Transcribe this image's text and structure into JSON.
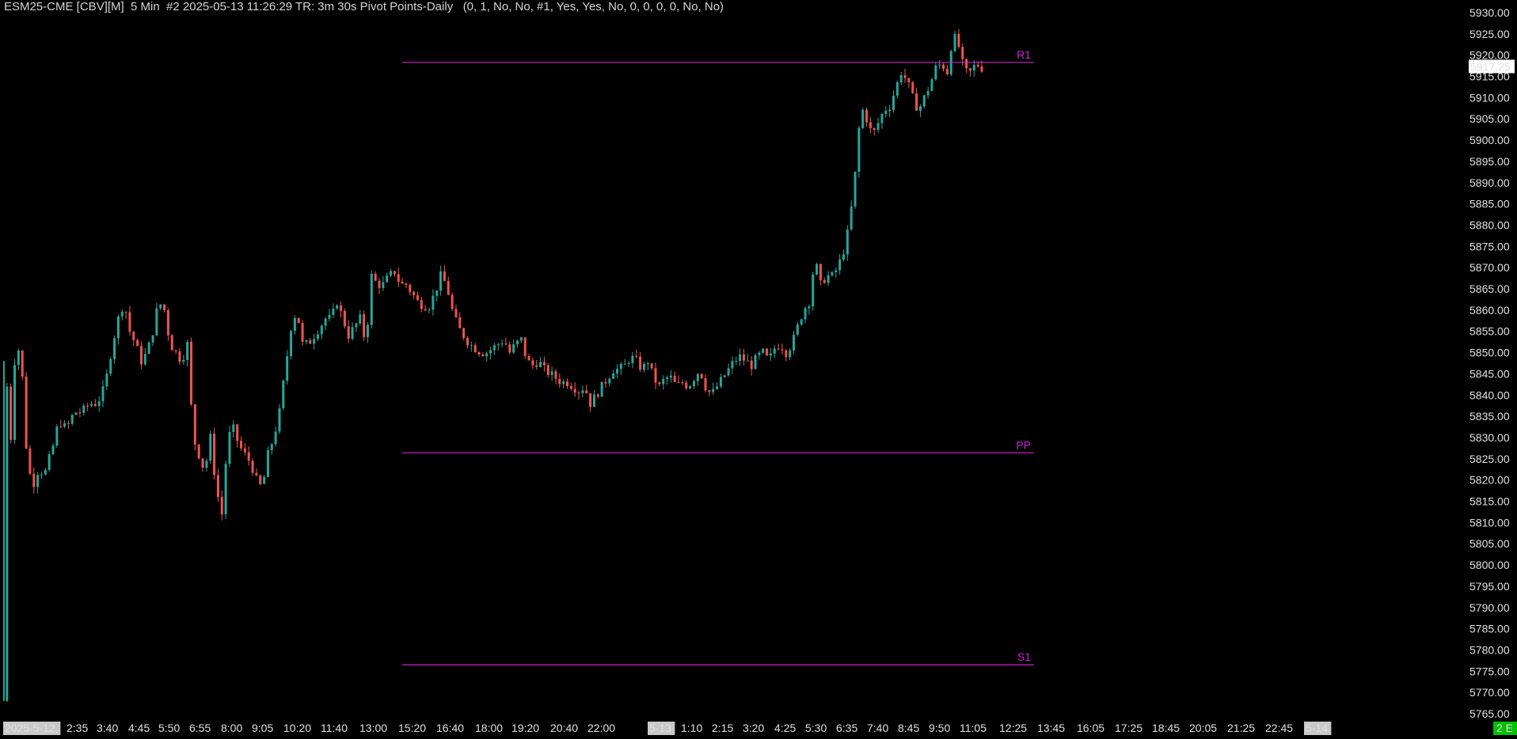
{
  "header": {
    "title": "ESM25-CME [CBV][M]  5 Min  #2 2025-05-13 11:26:29 TR: 3m 30s Pivot Points-Daily   (0, 1, No, No, #1, Yes, Yes, No, 0, 0, 0, 0, No, No)"
  },
  "colors": {
    "background": "#000000",
    "up_candle": "#26a69a",
    "down_candle": "#ef5350",
    "pivot_line": "#d020d0",
    "current_price_bg": "#ffffff",
    "current_price_text": "#000000",
    "date_marker_bg": "#c8c8c8",
    "status_badge_bg": "#00c000"
  },
  "chart_data": {
    "type": "candlestick",
    "symbol": "ESM25-CME [CBV][M]",
    "interval": "5 Min",
    "ylim": [
      5765,
      5930
    ],
    "y_ticks": [
      "5930.00",
      "5925.00",
      "5920.00",
      "5915.00",
      "5910.00",
      "5905.00",
      "5900.00",
      "5895.00",
      "5890.00",
      "5885.00",
      "5880.00",
      "5875.00",
      "5870.00",
      "5865.00",
      "5860.00",
      "5855.00",
      "5850.00",
      "5845.00",
      "5840.00",
      "5835.00",
      "5830.00",
      "5825.00",
      "5820.00",
      "5815.00",
      "5810.00",
      "5805.00",
      "5800.00",
      "5795.00",
      "5790.00",
      "5785.00",
      "5780.00",
      "5775.00",
      "5770.00",
      "5765.00"
    ],
    "x_ticks": [
      {
        "label": "2025-5-12",
        "boxed": true
      },
      {
        "label": "2:35"
      },
      {
        "label": "3:40"
      },
      {
        "label": "4:45"
      },
      {
        "label": "5:50"
      },
      {
        "label": "6:55"
      },
      {
        "label": "8:00"
      },
      {
        "label": "9:05"
      },
      {
        "label": "10:20"
      },
      {
        "label": "11:40"
      },
      {
        "label": "13:00"
      },
      {
        "label": "15:20"
      },
      {
        "label": "16:40"
      },
      {
        "label": "18:00"
      },
      {
        "label": "19:20"
      },
      {
        "label": "20:40"
      },
      {
        "label": "22:00"
      },
      {
        "label": "5-13",
        "boxed": true
      },
      {
        "label": "1:10"
      },
      {
        "label": "2:15"
      },
      {
        "label": "3:20"
      },
      {
        "label": "4:25"
      },
      {
        "label": "5:30"
      },
      {
        "label": "6:35"
      },
      {
        "label": "7:40"
      },
      {
        "label": "8:45"
      },
      {
        "label": "9:50"
      },
      {
        "label": "11:05"
      },
      {
        "label": "12:25"
      },
      {
        "label": "13:45"
      },
      {
        "label": "16:05"
      },
      {
        "label": "17:25"
      },
      {
        "label": "18:45"
      },
      {
        "label": "20:05"
      },
      {
        "label": "21:25"
      },
      {
        "label": "22:45"
      },
      {
        "label": "5-14",
        "boxed": true
      }
    ],
    "current_price": "5917.25",
    "pivot_levels": [
      {
        "name": "R1",
        "value": 5918.3
      },
      {
        "name": "PP",
        "value": 5826.4
      },
      {
        "name": "S1",
        "value": 5776.5
      }
    ],
    "price_path": [
      [
        0,
        5768
      ],
      [
        3,
        5845
      ],
      [
        8,
        5830
      ],
      [
        12,
        5848
      ],
      [
        18,
        5852
      ],
      [
        24,
        5828
      ],
      [
        30,
        5818
      ],
      [
        36,
        5822
      ],
      [
        44,
        5822
      ],
      [
        52,
        5828
      ],
      [
        58,
        5834
      ],
      [
        66,
        5832
      ],
      [
        74,
        5836
      ],
      [
        82,
        5836
      ],
      [
        90,
        5838
      ],
      [
        98,
        5838
      ],
      [
        106,
        5842
      ],
      [
        114,
        5852
      ],
      [
        120,
        5858
      ],
      [
        126,
        5862
      ],
      [
        132,
        5855
      ],
      [
        138,
        5852
      ],
      [
        144,
        5848
      ],
      [
        150,
        5850
      ],
      [
        156,
        5855
      ],
      [
        162,
        5862
      ],
      [
        168,
        5860
      ],
      [
        174,
        5852
      ],
      [
        180,
        5850
      ],
      [
        186,
        5848
      ],
      [
        192,
        5852
      ],
      [
        198,
        5830
      ],
      [
        204,
        5826
      ],
      [
        210,
        5822
      ],
      [
        216,
        5830
      ],
      [
        222,
        5818
      ],
      [
        228,
        5812
      ],
      [
        234,
        5830
      ],
      [
        240,
        5832
      ],
      [
        246,
        5828
      ],
      [
        252,
        5826
      ],
      [
        258,
        5824
      ],
      [
        264,
        5820
      ],
      [
        270,
        5818
      ],
      [
        276,
        5826
      ],
      [
        282,
        5830
      ],
      [
        288,
        5836
      ],
      [
        294,
        5846
      ],
      [
        300,
        5856
      ],
      [
        306,
        5860
      ],
      [
        312,
        5852
      ],
      [
        318,
        5852
      ],
      [
        324,
        5854
      ],
      [
        330,
        5856
      ],
      [
        336,
        5858
      ],
      [
        342,
        5858
      ],
      [
        348,
        5862
      ],
      [
        354,
        5858
      ],
      [
        360,
        5854
      ],
      [
        366,
        5856
      ],
      [
        372,
        5858
      ],
      [
        378,
        5852
      ],
      [
        384,
        5868
      ],
      [
        390,
        5866
      ],
      [
        396,
        5866
      ],
      [
        402,
        5868
      ],
      [
        408,
        5869
      ],
      [
        414,
        5866
      ],
      [
        420,
        5866
      ],
      [
        426,
        5864
      ],
      [
        432,
        5862
      ],
      [
        438,
        5861
      ],
      [
        444,
        5861
      ],
      [
        450,
        5864
      ],
      [
        456,
        5868
      ],
      [
        462,
        5866
      ],
      [
        468,
        5860
      ],
      [
        474,
        5856
      ],
      [
        480,
        5854
      ],
      [
        486,
        5852
      ],
      [
        492,
        5851
      ],
      [
        498,
        5850
      ],
      [
        504,
        5850
      ],
      [
        510,
        5851
      ],
      [
        516,
        5852
      ],
      [
        522,
        5853
      ],
      [
        528,
        5850
      ],
      [
        534,
        5852
      ],
      [
        540,
        5853
      ],
      [
        546,
        5848
      ],
      [
        552,
        5847
      ],
      [
        558,
        5848
      ],
      [
        564,
        5846
      ],
      [
        570,
        5845
      ],
      [
        576,
        5844
      ],
      [
        582,
        5843
      ],
      [
        588,
        5843
      ],
      [
        594,
        5842
      ],
      [
        600,
        5841
      ],
      [
        606,
        5842
      ],
      [
        612,
        5838
      ],
      [
        618,
        5840
      ],
      [
        624,
        5842
      ],
      [
        630,
        5844
      ],
      [
        636,
        5846
      ],
      [
        642,
        5846
      ],
      [
        648,
        5847
      ],
      [
        654,
        5849
      ],
      [
        660,
        5848
      ],
      [
        666,
        5846
      ],
      [
        672,
        5848
      ],
      [
        678,
        5844
      ],
      [
        684,
        5842
      ],
      [
        690,
        5844
      ],
      [
        696,
        5844
      ],
      [
        702,
        5842
      ],
      [
        708,
        5843
      ],
      [
        714,
        5842
      ],
      [
        720,
        5844
      ],
      [
        726,
        5846
      ],
      [
        732,
        5842
      ],
      [
        738,
        5840
      ],
      [
        744,
        5842
      ],
      [
        750,
        5844
      ],
      [
        756,
        5846
      ],
      [
        762,
        5848
      ],
      [
        768,
        5849
      ],
      [
        774,
        5848
      ],
      [
        780,
        5847
      ],
      [
        786,
        5849
      ],
      [
        792,
        5850
      ],
      [
        798,
        5848
      ],
      [
        804,
        5851
      ],
      [
        810,
        5852
      ],
      [
        816,
        5850
      ],
      [
        822,
        5852
      ],
      [
        828,
        5856
      ],
      [
        834,
        5860
      ],
      [
        840,
        5862
      ],
      [
        846,
        5872
      ],
      [
        852,
        5866
      ],
      [
        858,
        5868
      ],
      [
        864,
        5868
      ],
      [
        870,
        5870
      ],
      [
        876,
        5874
      ],
      [
        882,
        5880
      ],
      [
        888,
        5892
      ],
      [
        894,
        5908
      ],
      [
        900,
        5905
      ],
      [
        906,
        5901
      ],
      [
        912,
        5904
      ],
      [
        918,
        5907
      ],
      [
        924,
        5908
      ],
      [
        930,
        5912
      ],
      [
        936,
        5916
      ],
      [
        942,
        5914
      ],
      [
        948,
        5910
      ],
      [
        954,
        5907
      ],
      [
        960,
        5910
      ],
      [
        966,
        5913
      ],
      [
        972,
        5917
      ],
      [
        978,
        5918
      ],
      [
        984,
        5916
      ],
      [
        990,
        5925
      ],
      [
        996,
        5922
      ],
      [
        1002,
        5916
      ],
      [
        1008,
        5916
      ],
      [
        1014,
        5918
      ],
      [
        1020,
        5917
      ]
    ]
  },
  "status": {
    "badge_text": "2 E"
  }
}
